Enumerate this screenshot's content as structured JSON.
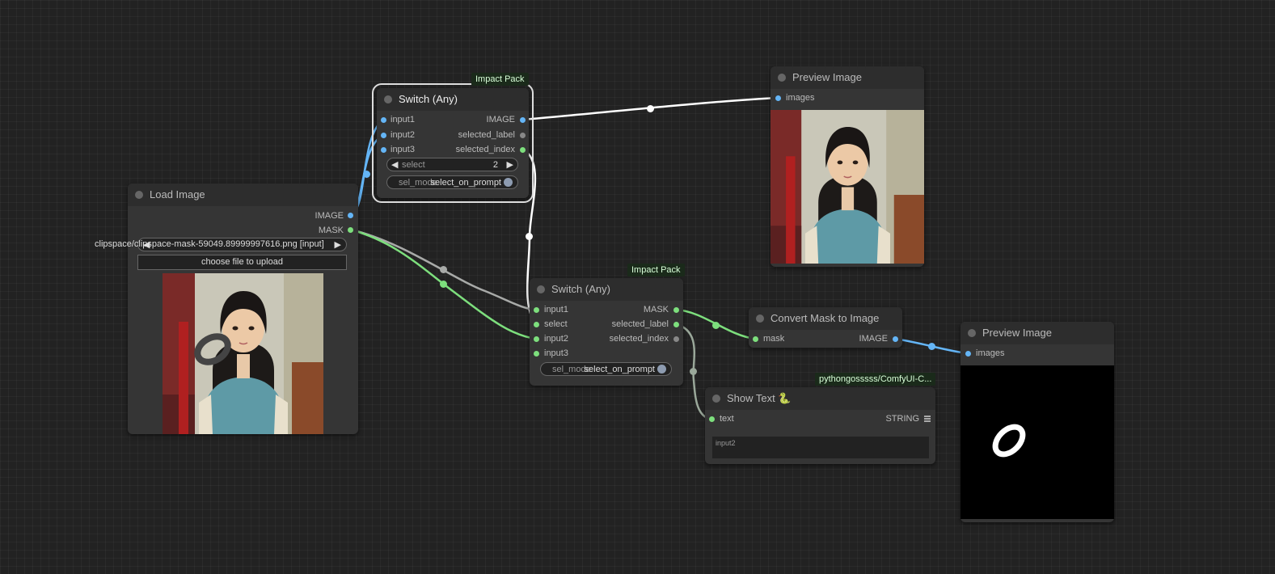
{
  "canvas": {
    "background": "#222222",
    "link_colors": {
      "image": "#64b5f6",
      "mask": "#7ddf7d",
      "string": "#9aa89a",
      "any": "#ffffff"
    }
  },
  "nodes": {
    "load_image": {
      "title": "Load Image",
      "outputs": [
        "IMAGE",
        "MASK"
      ],
      "file_widget_value": "clipspace/clipspace-mask-59049.89999997616.png [input]",
      "upload_button": "choose file to upload",
      "preview_icon": "person-photo-with-mask-stroke"
    },
    "switch_top": {
      "badge": "Impact Pack",
      "title": "Switch (Any)",
      "inputs": [
        "input1",
        "input2",
        "input3"
      ],
      "outputs": [
        "IMAGE",
        "selected_label",
        "selected_index"
      ],
      "select_label": "select",
      "select_value": "2",
      "sel_mode_label": "sel_mode",
      "sel_mode_value": "select_on_prompt"
    },
    "preview_top": {
      "title": "Preview Image",
      "inputs": [
        "images"
      ],
      "preview_icon": "person-photo"
    },
    "switch_mid": {
      "badge": "Impact Pack",
      "title": "Switch (Any)",
      "inputs": [
        "input1",
        "select",
        "input2",
        "input3"
      ],
      "outputs": [
        "MASK",
        "selected_label",
        "selected_index"
      ],
      "sel_mode_label": "sel_mode",
      "sel_mode_value": "select_on_prompt"
    },
    "convert_mask": {
      "title": "Convert Mask to Image",
      "inputs": [
        "mask"
      ],
      "outputs": [
        "IMAGE"
      ]
    },
    "show_text": {
      "badge": "pythongosssss/ComfyUI-C...",
      "title": "Show Text 🐍",
      "inputs": [
        "text"
      ],
      "outputs": [
        "STRING"
      ],
      "text_value": "input2"
    },
    "preview_right": {
      "title": "Preview Image",
      "inputs": [
        "images"
      ],
      "preview_icon": "mask-stroke-on-black"
    }
  }
}
